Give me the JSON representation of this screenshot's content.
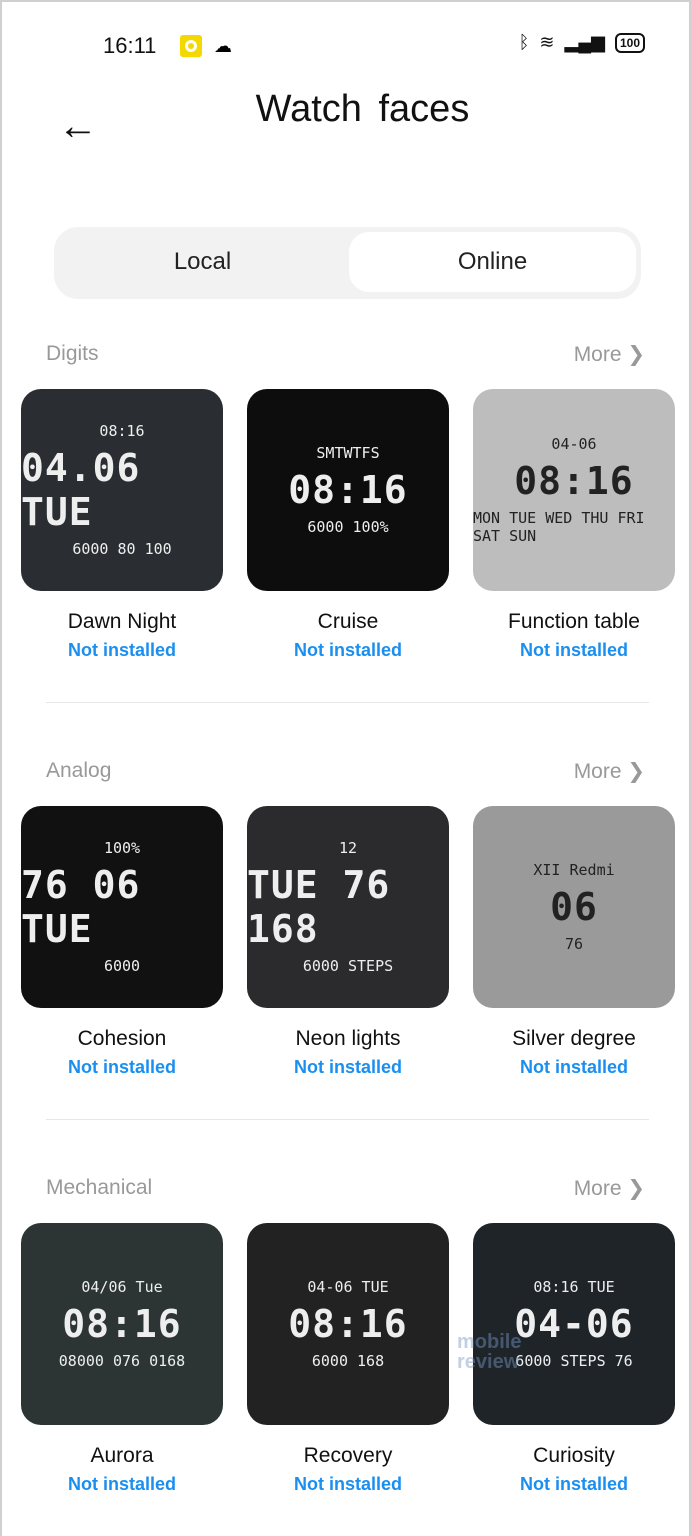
{
  "status_bar": {
    "time": "16:11",
    "icons": [
      "notification-icon",
      "cloud-icon",
      "bluetooth-icon",
      "wifi-icon",
      "signal-icon"
    ],
    "battery": "100"
  },
  "header": {
    "title": "Watch faces",
    "back_icon": "arrow-left-icon"
  },
  "tabs": [
    {
      "label": "Local",
      "selected": false
    },
    {
      "label": "Online",
      "selected": true
    }
  ],
  "accent_color": "#1a8ff0",
  "watermark": "mobile review",
  "sections": [
    {
      "title": "Digits",
      "more": "More",
      "faces": [
        {
          "name": "Dawn Night",
          "status": "Not installed",
          "bg": "#2a2d31",
          "top": "08:16",
          "mid": "04.06 TUE",
          "bot": "6000  80  100"
        },
        {
          "name": "Cruise",
          "status": "Not installed",
          "bg": "#0d0d0d",
          "top": "SMTWTFS",
          "mid": "08:16",
          "bot": "6000 100%"
        },
        {
          "name": "Function table",
          "status": "Not installed",
          "bg": "#bdbdbd",
          "top": "04-06",
          "mid": "08:16",
          "bot": "MON TUE WED THU FRI SAT SUN"
        }
      ]
    },
    {
      "title": "Analog",
      "more": "More",
      "faces": [
        {
          "name": "Cohesion",
          "status": "Not installed",
          "bg": "#111",
          "top": "100%",
          "mid": "76  06 TUE",
          "bot": "6000"
        },
        {
          "name": "Neon lights",
          "status": "Not installed",
          "bg": "#2b2b2d",
          "top": "12",
          "mid": "TUE  76 168",
          "bot": "6000 STEPS"
        },
        {
          "name": "Silver degree",
          "status": "Not installed",
          "bg": "#9a9a9a",
          "top": "XII Redmi",
          "mid": "06",
          "bot": "76"
        }
      ]
    },
    {
      "title": "Mechanical",
      "more": "More",
      "faces": [
        {
          "name": "Aurora",
          "status": "Not installed",
          "bg": "#2c3533",
          "top": "04/06 Tue",
          "mid": "08:16",
          "bot": "08000 076 0168"
        },
        {
          "name": "Recovery",
          "status": "Not installed",
          "bg": "#222",
          "top": "04-06 TUE",
          "mid": "08:16",
          "bot": "6000 168"
        },
        {
          "name": "Curiosity",
          "status": "Not installed",
          "bg": "#1e2428",
          "top": "08:16 TUE",
          "mid": "04-06",
          "bot": "6000 STEPS 76"
        }
      ]
    }
  ]
}
